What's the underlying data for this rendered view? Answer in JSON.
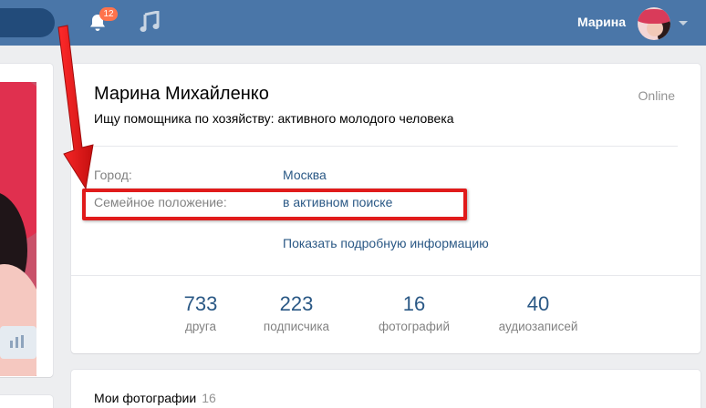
{
  "header": {
    "notifications_count": "12",
    "user_name": "Марина",
    "icons": [
      "bell-icon",
      "music-icon",
      "chevron-down-icon"
    ],
    "colors": {
      "bar": "#4a76a8",
      "badge": "#ff734c"
    }
  },
  "profile": {
    "name": "Марина Михайленко",
    "online_status": "Online",
    "status_text": "Ищу помощника по хозяйству: активного молодого человека",
    "info_rows": [
      {
        "label": "Город:",
        "value": "Москва"
      },
      {
        "label": "Семейное положение:",
        "value": "в активном поиске"
      }
    ],
    "show_more": "Показать подробную информацию",
    "counters": [
      {
        "value": "733",
        "label": "друга"
      },
      {
        "value": "223",
        "label": "подписчика"
      },
      {
        "value": "16",
        "label": "фотографий"
      },
      {
        "value": "40",
        "label": "аудиозаписей"
      }
    ]
  },
  "photos": {
    "title": "Мои фотографии",
    "count": "16"
  },
  "annotation": {
    "color": "#e01b1b"
  }
}
